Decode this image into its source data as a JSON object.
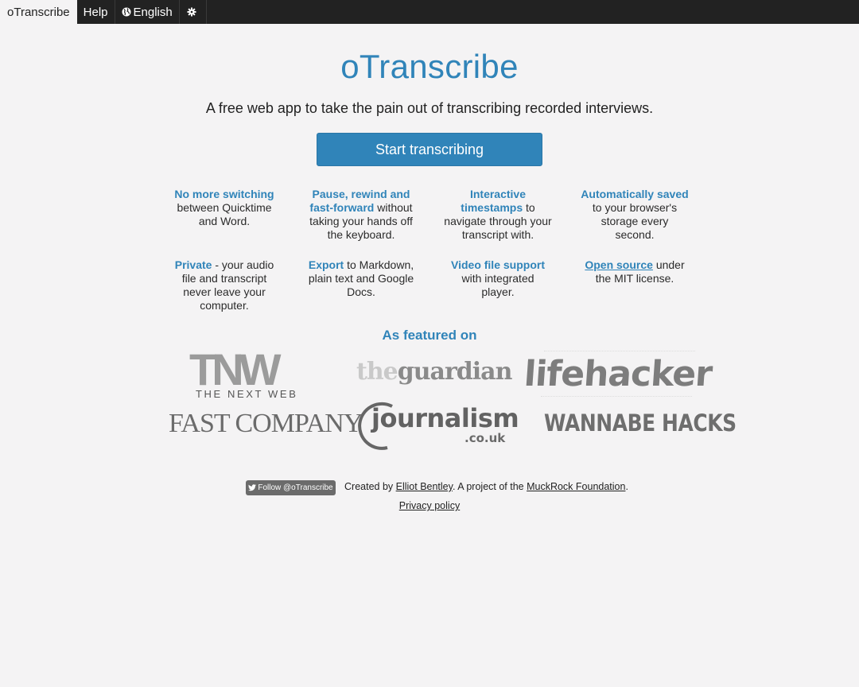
{
  "nav": {
    "tabs": [
      {
        "label": "oTranscribe"
      },
      {
        "label": "Help"
      },
      {
        "label": "English",
        "icon": "globe-icon"
      },
      {
        "label": "",
        "icon": "gear-icon"
      }
    ]
  },
  "hero": {
    "title": "oTranscribe",
    "tagline": "A free web app to take the pain out of transcribing recorded interviews.",
    "start_button": "Start transcribing"
  },
  "features": [
    {
      "highlight": "No more switching",
      "text": " between Quicktime and Word."
    },
    {
      "highlight": "Pause, rewind and fast-forward",
      "text": " without taking your hands off the keyboard."
    },
    {
      "highlight": "Interactive timestamps",
      "text": " to navigate through your transcript with."
    },
    {
      "highlight": "Automatically saved",
      "text": " to your browser's storage every second."
    },
    {
      "highlight": "Private",
      "text": " - your audio file and transcript never leave your computer."
    },
    {
      "highlight": "Export",
      "text": " to Markdown, plain text and Google Docs."
    },
    {
      "highlight": "Video file support",
      "text": " with integrated player."
    },
    {
      "highlight": "Open source",
      "text": " under the MIT license."
    }
  ],
  "featured": {
    "heading": "As featured on",
    "logos": {
      "tnw_mark": "TNW",
      "tnw_text": "THE NEXT WEB",
      "guardian_the": "the",
      "guardian_word": "guardian",
      "lifehacker": "lifehacker",
      "fastcompany": "FAST COMPANY",
      "journalism": "journalism",
      "journalism_suffix": ".co.uk",
      "wannabehacks": "WANNABE HACKS"
    }
  },
  "footer": {
    "follow_button": "Follow @oTranscribe",
    "created_by": "Created by ",
    "author": "Elliot Bentley",
    "project_of": ". A project of the ",
    "foundation": "MuckRock Foundation",
    "period": ".",
    "privacy": "Privacy policy"
  },
  "colors": {
    "accent": "#3084b9",
    "topbar": "#222222",
    "background": "#f4f3f4"
  }
}
